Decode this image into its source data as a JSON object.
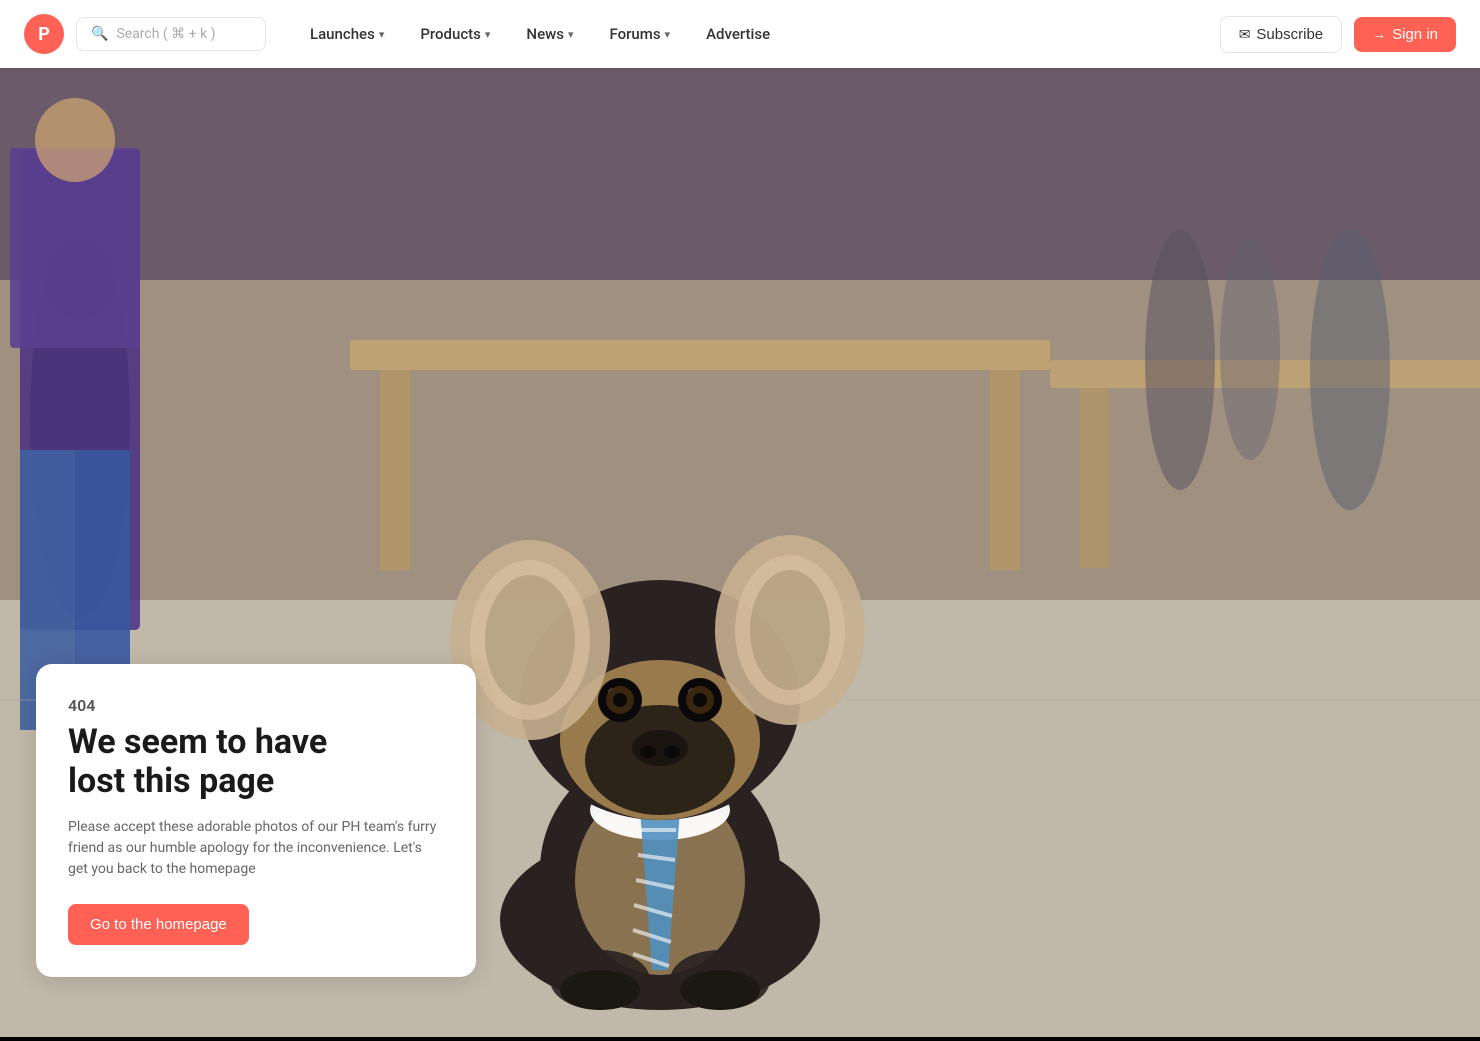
{
  "brand": {
    "logo_letter": "P",
    "logo_color": "#ff6154"
  },
  "search": {
    "placeholder": "Search ( ⌘ + k )"
  },
  "nav": {
    "items": [
      {
        "label": "Launches",
        "has_chevron": true,
        "id": "launches"
      },
      {
        "label": "Products",
        "has_chevron": true,
        "id": "products"
      },
      {
        "label": "News",
        "has_chevron": true,
        "id": "news"
      },
      {
        "label": "Forums",
        "has_chevron": true,
        "id": "forums"
      },
      {
        "label": "Advertise",
        "has_chevron": false,
        "id": "advertise"
      }
    ]
  },
  "nav_right": {
    "subscribe_label": "Subscribe",
    "signin_label": "Sign in"
  },
  "error_page": {
    "code": "404",
    "title_line1": "We seem to have",
    "title_line2": "lost this page",
    "description": "Please accept these adorable photos of our PH team's furry friend as our humble apology for the inconvenience. Let's get you back to the homepage",
    "cta_label": "Go to the homepage"
  }
}
